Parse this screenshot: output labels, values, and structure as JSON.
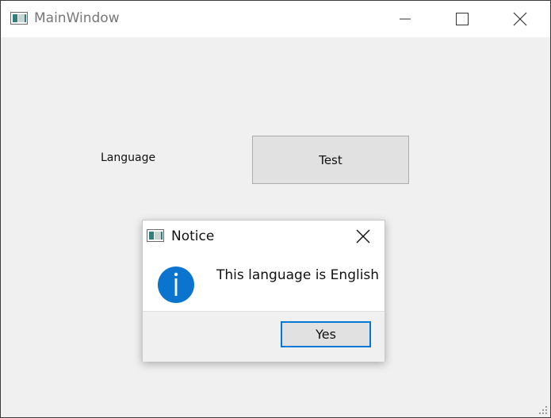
{
  "main_window": {
    "title": "MainWindow",
    "language_label": "Language",
    "test_button_label": "Test"
  },
  "dialog": {
    "title": "Notice",
    "message": "This language is English",
    "yes_button_label": "Yes"
  },
  "icons": {
    "app": "app-icon",
    "minimize": "minimize-icon",
    "maximize": "maximize-icon",
    "close": "close-icon",
    "info": "info-icon",
    "resize": "resize-grip-icon"
  },
  "colors": {
    "accent": "#0078d7",
    "info_icon": "#0a74cf",
    "background": "#f0f0f0"
  }
}
